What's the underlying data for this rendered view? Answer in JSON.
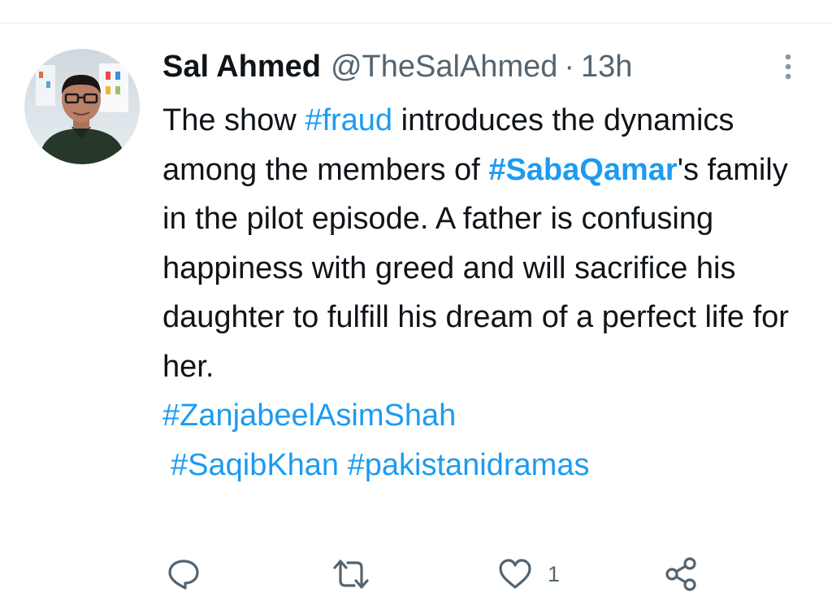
{
  "tweet": {
    "author": {
      "display_name": "Sal Ahmed",
      "handle": "@TheSalAhmed",
      "separator": "·",
      "time": "13h",
      "avatar_icon": "profile-photo"
    },
    "text": {
      "p1": "The show ",
      "h1": "#fraud",
      "p2": " introduces the dynamics among the members of ",
      "h2": "#SabaQamar",
      "p3": "'s family in the pilot episode. A father is confusing happiness with greed and will sacrifice his daughter to fulfill his dream of a perfect life for her.",
      "h3": "#ZanjabeelAsimShah",
      "h4": "#SaqibKhan",
      "h5": "#pakistanidramas"
    },
    "actions": {
      "reply_icon": "reply-icon",
      "retweet_icon": "retweet-icon",
      "like_icon": "heart-icon",
      "like_count": "1",
      "share_icon": "share-icon",
      "more_icon": "more-icon"
    },
    "colors": {
      "text": "#0f1419",
      "secondary": "#536471",
      "link": "#1d9bf0"
    }
  }
}
